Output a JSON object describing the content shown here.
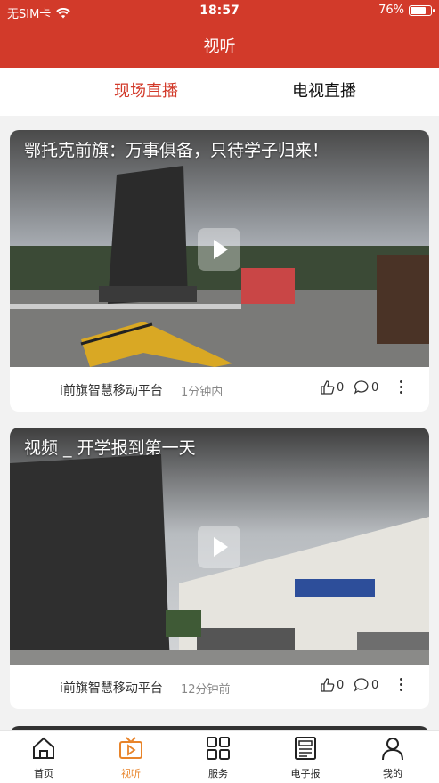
{
  "status_bar": {
    "carrier": "无SIM卡",
    "time": "18:57",
    "battery_percent": "76%",
    "battery_level": 0.76
  },
  "header": {
    "title": "视听",
    "background_color": "#d23a2a"
  },
  "tabs": [
    {
      "label": "现场直播",
      "active": true
    },
    {
      "label": "电视直播",
      "active": false
    }
  ],
  "videos": [
    {
      "title": "鄂托克前旗：万事俱备，只待学子归来！",
      "source": "i前旗智慧移动平台",
      "time": "1分钟内",
      "likes": "0",
      "comments": "0"
    },
    {
      "title": "视频 _ 开学报到第一天",
      "source": "i前旗智慧移动平台",
      "time": "12分钟前",
      "likes": "0",
      "comments": "0"
    }
  ],
  "bottom_nav": [
    {
      "label": "首页",
      "icon": "home-icon",
      "active": false
    },
    {
      "label": "视听",
      "icon": "tv-play-icon",
      "active": true
    },
    {
      "label": "服务",
      "icon": "grid-icon",
      "active": false
    },
    {
      "label": "电子报",
      "icon": "newspaper-icon",
      "active": false
    },
    {
      "label": "我的",
      "icon": "person-icon",
      "active": false
    }
  ],
  "colors": {
    "accent": "#d23a2a",
    "nav_active": "#e8842a"
  }
}
